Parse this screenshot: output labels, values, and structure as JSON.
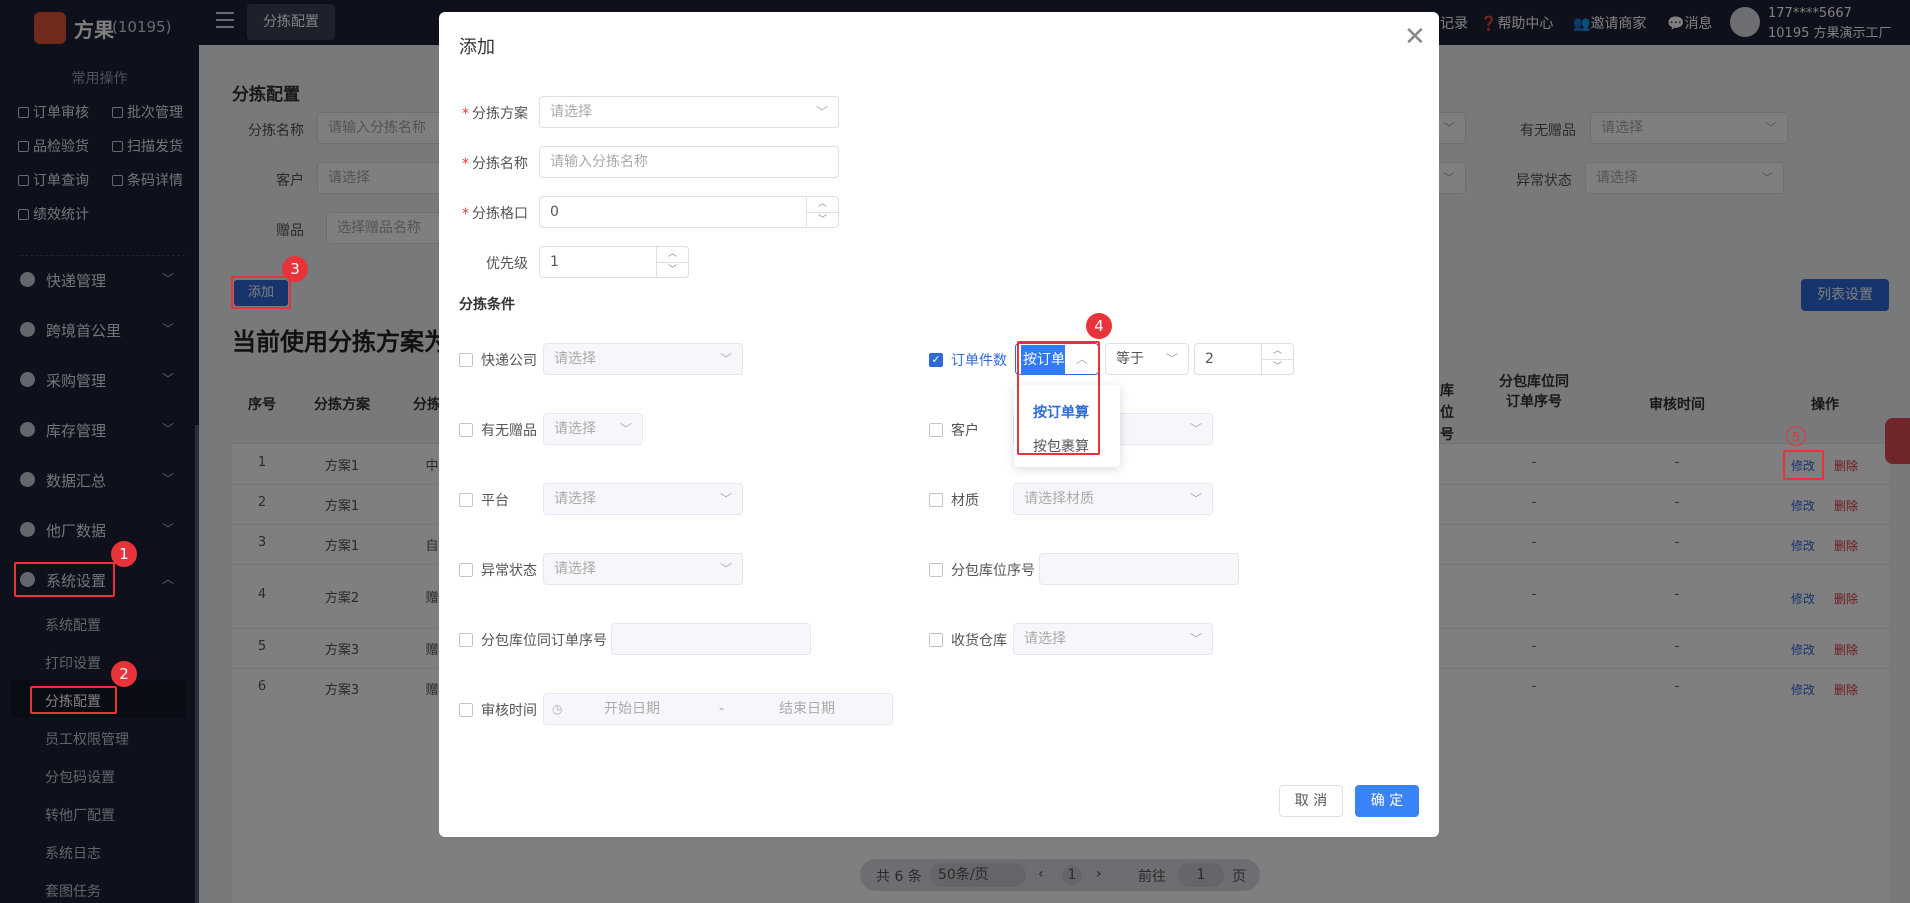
{
  "app": {
    "logo_text": "方果",
    "company_code": "(10195)"
  },
  "sidebar": {
    "quick_title": "常用操作",
    "quick_ops": [
      "订单审核",
      "批次管理",
      "品检验货",
      "扫描发货",
      "订单查询",
      "条码详情",
      "绩效统计"
    ],
    "menus": [
      "快递管理",
      "跨境首公里",
      "采购管理",
      "库存管理",
      "数据汇总",
      "他厂数据",
      "系统设置"
    ],
    "submenus": [
      "系统配置",
      "打印设置",
      "分拣配置",
      "员工权限管理",
      "分包码设置",
      "转他厂配置",
      "系统日志",
      "套图任务"
    ]
  },
  "topbar": {
    "active_tab": "分拣配置",
    "record": "记录",
    "help": "帮助中心",
    "invite": "邀请商家",
    "message": "消息",
    "user_phone": "177****5667",
    "user_name": "10195 方果演示工厂"
  },
  "page": {
    "title": "分拣配置",
    "filters": {
      "name_label": "分拣名称",
      "name_placeholder": "请输入分拣名称",
      "customer_label": "客户",
      "customer_placeholder": "请选择",
      "gift_label": "赠品",
      "gift_placeholder": "选择赠品名称",
      "has_gift_label": "有无赠品",
      "has_gift_placeholder": "请选择",
      "abnormal_label": "异常状态",
      "abnormal_placeholder": "请选择"
    },
    "add_button": "添加",
    "column_settings": "列表设置",
    "current_title": "当前使用分拣方案为",
    "columns": {
      "no": "序号",
      "plan": "分拣方案",
      "partial": "分拣",
      "loc_partial": "库位号",
      "sub_loc": "分包库位同订单序号",
      "audit_time": "审核时间",
      "ops": "操作"
    },
    "rows": [
      {
        "no": "1",
        "plan": "方案1",
        "cell": "中",
        "sub": "-",
        "audit": "-"
      },
      {
        "no": "2",
        "plan": "方案1",
        "cell": "",
        "sub": "-",
        "audit": "-"
      },
      {
        "no": "3",
        "plan": "方案1",
        "cell": "自",
        "sub": "-",
        "audit": "-"
      },
      {
        "no": "4",
        "plan": "方案2",
        "cell": "赠",
        "sub": "-",
        "audit": "-"
      },
      {
        "no": "5",
        "plan": "方案3",
        "cell": "赠",
        "sub": "-",
        "audit": "-"
      },
      {
        "no": "6",
        "plan": "方案3",
        "cell": "赠",
        "sub": "-",
        "audit": "-"
      }
    ],
    "edit_label": "修改",
    "delete_label": "删除",
    "pager": {
      "total": "共 6 条",
      "page_size": "50条/页",
      "current": "1",
      "goto_label": "前往",
      "goto_value": "1",
      "page_unit": "页"
    }
  },
  "dialog": {
    "title": "添加",
    "plan_label": "分拣方案",
    "plan_placeholder": "请选择",
    "name_label": "分拣名称",
    "name_placeholder": "请输入分拣名称",
    "slot_label": "分拣格口",
    "slot_value": "0",
    "priority_label": "优先级",
    "priority_value": "1",
    "conditions_title": "分拣条件",
    "express_label": "快递公司",
    "express_placeholder": "请选择",
    "order_count_label": "订单件数",
    "order_count_mode": "按订单",
    "order_count_op": "等于",
    "order_count_value": "2",
    "dropdown_options": [
      "按订单算",
      "按包裹算"
    ],
    "has_gift_label": "有无赠品",
    "has_gift_placeholder": "请选择",
    "customer_label": "客户",
    "platform_label": "平台",
    "platform_placeholder": "请选择",
    "material_label": "材质",
    "material_placeholder": "请选择材质",
    "abnormal_label": "异常状态",
    "abnormal_placeholder": "请选择",
    "sub_loc_label": "分包库位序号",
    "sub_loc_order_label": "分包库位同订单序号",
    "warehouse_label": "收货仓库",
    "warehouse_placeholder": "请选择",
    "audit_label": "审核时间",
    "start_placeholder": "开始日期",
    "date_sep": "-",
    "end_placeholder": "结束日期",
    "cancel": "取 消",
    "ok": "确 定"
  },
  "annotations": [
    "1",
    "2",
    "3",
    "4",
    "5"
  ],
  "colors": {
    "accent": "#2f6bd8",
    "annotation": "#e8333a",
    "sidebar": "#1d2236"
  }
}
